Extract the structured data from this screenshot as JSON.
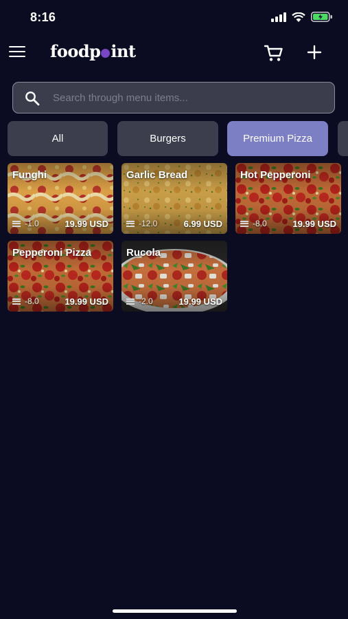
{
  "status_bar": {
    "time": "8:16"
  },
  "header": {
    "logo_before": "foodp",
    "logo_after": "int"
  },
  "search": {
    "placeholder": "Search through menu items..."
  },
  "categories": [
    {
      "label": "All",
      "active": false
    },
    {
      "label": "Burgers",
      "active": false
    },
    {
      "label": "Premium Pizza",
      "active": true
    }
  ],
  "items": [
    {
      "name": "Funghi",
      "stock": "-1.0",
      "price": "19.99 USD",
      "image": "pizza-cheese"
    },
    {
      "name": "Garlic Bread",
      "stock": "-12.0",
      "price": "6.99 USD",
      "image": "garlic-bread"
    },
    {
      "name": "Hot Pepperoni",
      "stock": "-8.0",
      "price": "19.99 USD",
      "image": "pizza-pepperoni"
    },
    {
      "name": "Pepperoni Pizza",
      "stock": "-8.0",
      "price": "19.99 USD",
      "image": "pizza-pepperoni"
    },
    {
      "name": "Rucola",
      "stock": "-2.0",
      "price": "19.99 USD",
      "image": "pizza-rucola"
    }
  ],
  "colors": {
    "background": "#0b0c22",
    "accent": "#7c7fc4",
    "logo_dot": "#7a47c4",
    "chip": "#3c3e4d"
  },
  "icons": [
    "menu-icon",
    "cart-icon",
    "plus-icon",
    "search-icon",
    "stock-icon"
  ]
}
